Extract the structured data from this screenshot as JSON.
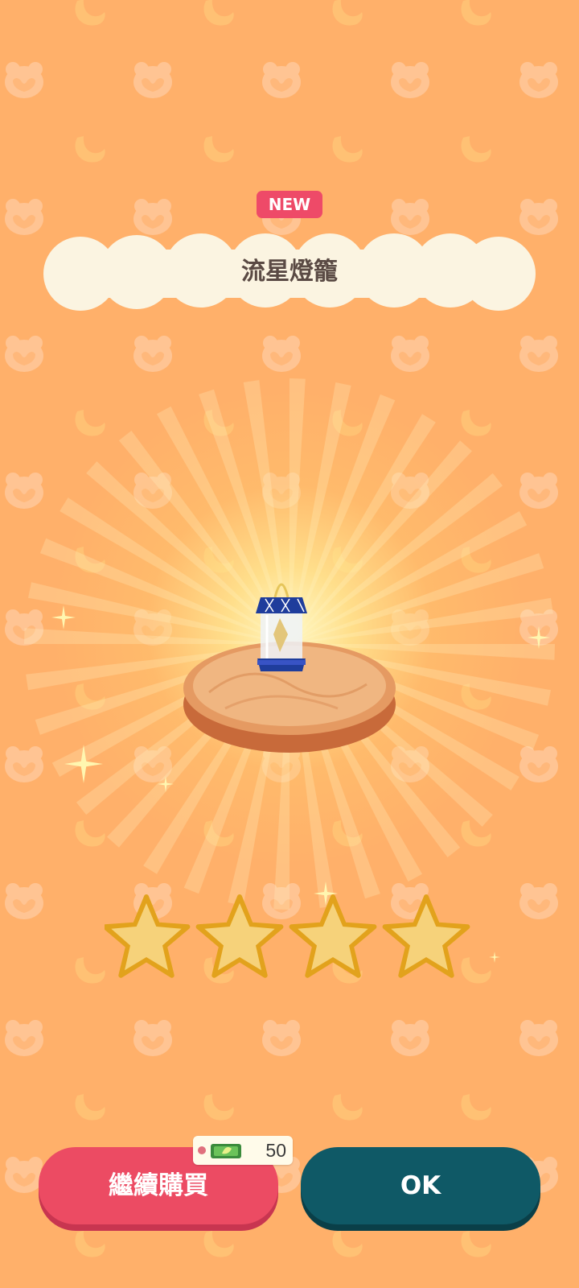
{
  "badge": {
    "label": "NEW"
  },
  "item": {
    "name": "流星燈籠"
  },
  "rating": {
    "stars": 4,
    "max": 4
  },
  "buttons": {
    "continue_label": "繼續購買",
    "ok_label": "OK"
  },
  "price": {
    "value": "50",
    "currency_icon": "leaf-ticket-icon"
  },
  "colors": {
    "background": "#ffb06a",
    "badge": "#ee4a68",
    "continue_button": "#ec4b63",
    "ok_button": "#0f5966",
    "star": "#f6d27a"
  }
}
